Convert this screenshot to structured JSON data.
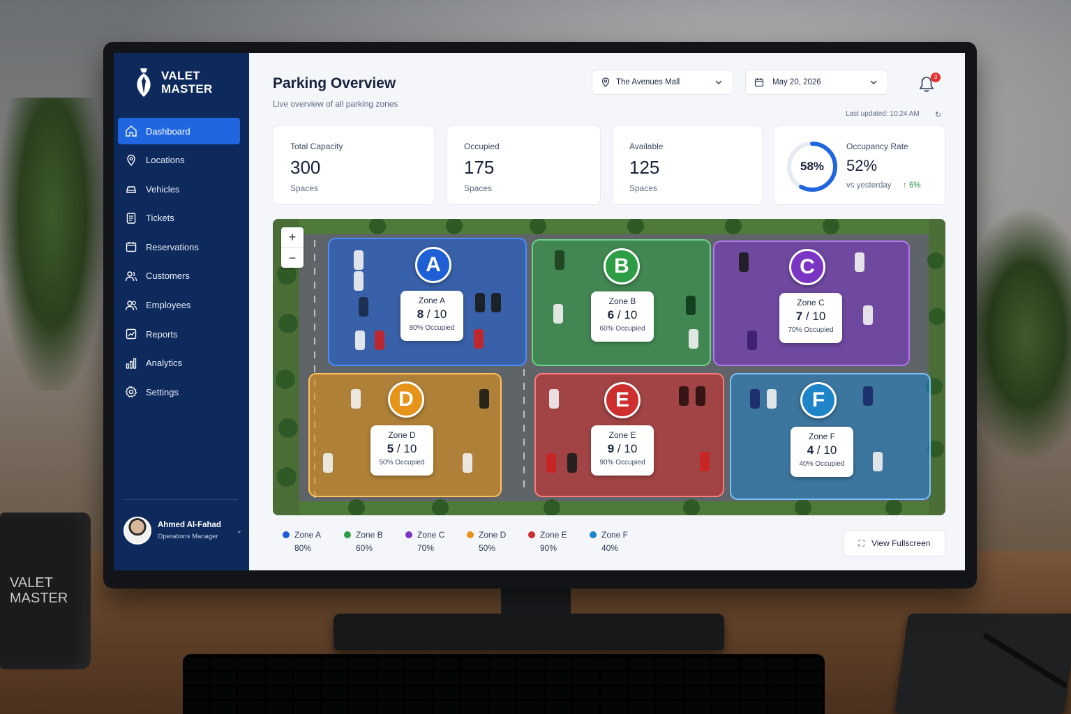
{
  "brand": {
    "line1": "VALET",
    "line2": "MASTER"
  },
  "mug": {
    "line1": "VALET",
    "line2": "MASTER"
  },
  "sidebar": {
    "items": [
      {
        "label": "Dashboard",
        "icon": "home-icon",
        "active": true
      },
      {
        "label": "Locations",
        "icon": "map-pin-icon"
      },
      {
        "label": "Vehicles",
        "icon": "car-icon"
      },
      {
        "label": "Tickets",
        "icon": "ticket-icon"
      },
      {
        "label": "Reservations",
        "icon": "calendar-icon"
      },
      {
        "label": "Customers",
        "icon": "users-icon"
      },
      {
        "label": "Employees",
        "icon": "employees-icon"
      },
      {
        "label": "Reports",
        "icon": "report-icon"
      },
      {
        "label": "Analytics",
        "icon": "bar-chart-icon"
      },
      {
        "label": "Settings",
        "icon": "gear-icon"
      }
    ],
    "user": {
      "name": "Ahmed Al-Fahad",
      "role": "Operations Manager"
    }
  },
  "header": {
    "title": "Parking Overview",
    "subtitle": "Live overview of all parking zones",
    "location": "The Avenues Mall",
    "date": "May 20, 2026",
    "notifications": "3",
    "last_updated": "Last updated: 10:24 AM"
  },
  "stats": {
    "total": {
      "label": "Total Capacity",
      "value": "300",
      "unit": "Spaces"
    },
    "occupied": {
      "label": "Occupied",
      "value": "175",
      "unit": "Spaces"
    },
    "available": {
      "label": "Available",
      "value": "125",
      "unit": "Spaces"
    },
    "occupancy": {
      "label": "Occupancy Rate",
      "ring": "58%",
      "ring_fraction": 0.58,
      "value": "52%",
      "vs": "vs yesterday",
      "delta": "↑ 6%"
    }
  },
  "zones": [
    {
      "letter": "A",
      "name": "Zone A",
      "occupied": "8",
      "capacity": "/ 10",
      "occ_text": "80% Occupied",
      "legend_pct": "80%",
      "color": "#1f5fd6"
    },
    {
      "letter": "B",
      "name": "Zone B",
      "occupied": "6",
      "capacity": "/ 10",
      "occ_text": "60% Occupied",
      "legend_pct": "60%",
      "color": "#2e9e46"
    },
    {
      "letter": "C",
      "name": "Zone C",
      "occupied": "7",
      "capacity": "/ 10",
      "occ_text": "70% Occupied",
      "legend_pct": "70%",
      "color": "#7a35c4"
    },
    {
      "letter": "D",
      "name": "Zone D",
      "occupied": "5",
      "capacity": "/ 10",
      "occ_text": "50% Occupied",
      "legend_pct": "50%",
      "color": "#e59319"
    },
    {
      "letter": "E",
      "name": "Zone E",
      "occupied": "9",
      "capacity": "/ 10",
      "occ_text": "90% Occupied",
      "legend_pct": "90%",
      "color": "#cf2e2e"
    },
    {
      "letter": "F",
      "name": "Zone F",
      "occupied": "4",
      "capacity": "/ 10",
      "occ_text": "40% Occupied",
      "legend_pct": "40%",
      "color": "#1f84c8"
    }
  ],
  "map": {
    "zoom_in": "+",
    "zoom_out": "−"
  },
  "fullscreen_label": "View Fullscreen"
}
